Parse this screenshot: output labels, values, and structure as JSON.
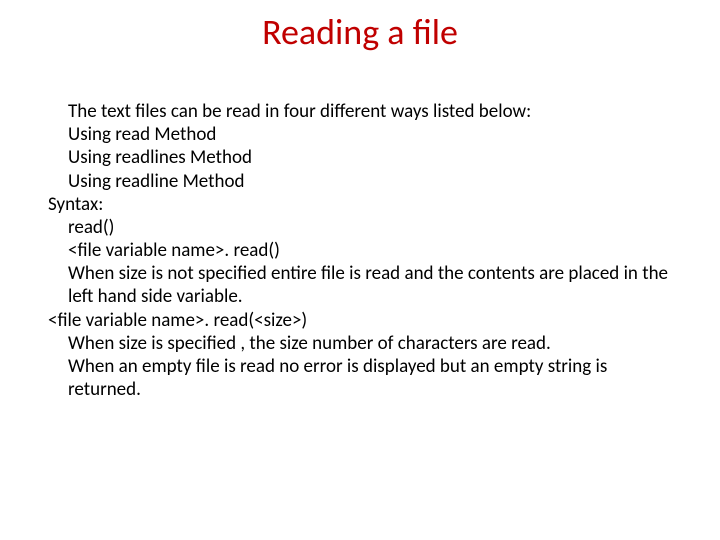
{
  "title": "Reading a file",
  "body": {
    "l1": "The text files can be read in four different ways listed below:",
    "l2": "Using read Method",
    "l3": "Using readlines Method",
    "l4": "Using readline Method",
    "l5": "Syntax:",
    "l6": "read()",
    "l7": "<file variable name>. read()",
    "l8": "When size is not specified entire file is read and the contents are placed in the left hand side variable.",
    "l9": "<file variable name>. read(<size>)",
    "l10": " When size is specified , the size number of characters are read.",
    "l11": "When an empty file is read no error is displayed but an empty string is returned."
  }
}
